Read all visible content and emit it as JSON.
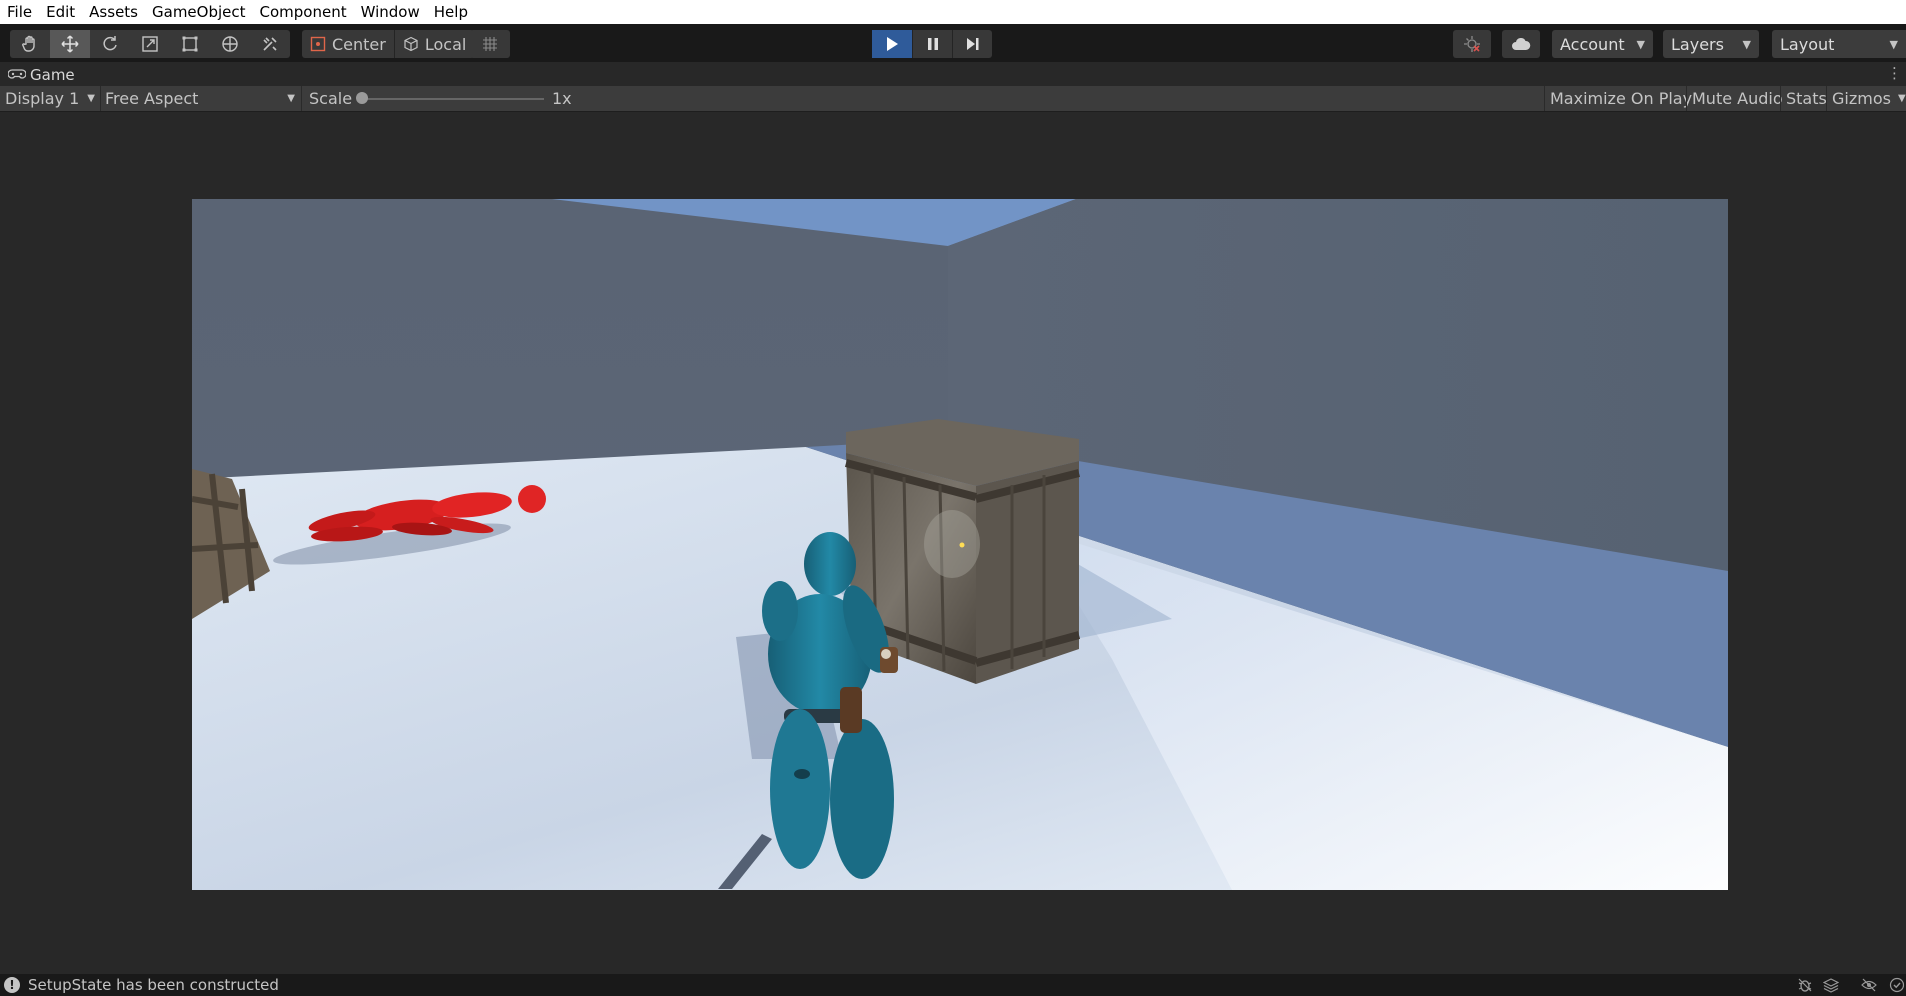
{
  "menu": [
    "File",
    "Edit",
    "Assets",
    "GameObject",
    "Component",
    "Window",
    "Help"
  ],
  "toolbar": {
    "pivot_mode": "Center",
    "pivot_rotation": "Local",
    "account": "Account",
    "layers": "Layers",
    "layout": "Layout",
    "icons": {
      "hand": "hand-tool-icon",
      "move": "move-tool-icon",
      "rotate": "rotate-tool-icon",
      "scale": "scale-tool-icon",
      "rect": "rect-tool-icon",
      "transform": "transform-tool-icon",
      "custom": "custom-tool-icon",
      "snap": "grid-snap-icon",
      "play": "play-icon",
      "pause": "pause-icon",
      "step": "step-icon",
      "collab": "collab-icon",
      "cloud": "cloud-icon"
    }
  },
  "game_view": {
    "tab_title": "Game",
    "display": "Display 1",
    "aspect": "Free Aspect",
    "scale_label": "Scale",
    "scale_value": "1x",
    "maximize_on_play": "Maximize On Play",
    "mute_audio": "Mute Audio",
    "stats": "Stats",
    "gizmos": "Gizmos"
  },
  "status": {
    "message": "SetupState has been constructed"
  },
  "colors": {
    "editor_bg": "#282828",
    "toolbar_bg": "#191919",
    "play_active": "#2f5b9a",
    "sky": "#6f8fbf",
    "wall": "#5c6676",
    "floor": "#dde6f2",
    "enemy": "#e02222",
    "player": "#1f7a95",
    "crate": "#6a6358"
  }
}
